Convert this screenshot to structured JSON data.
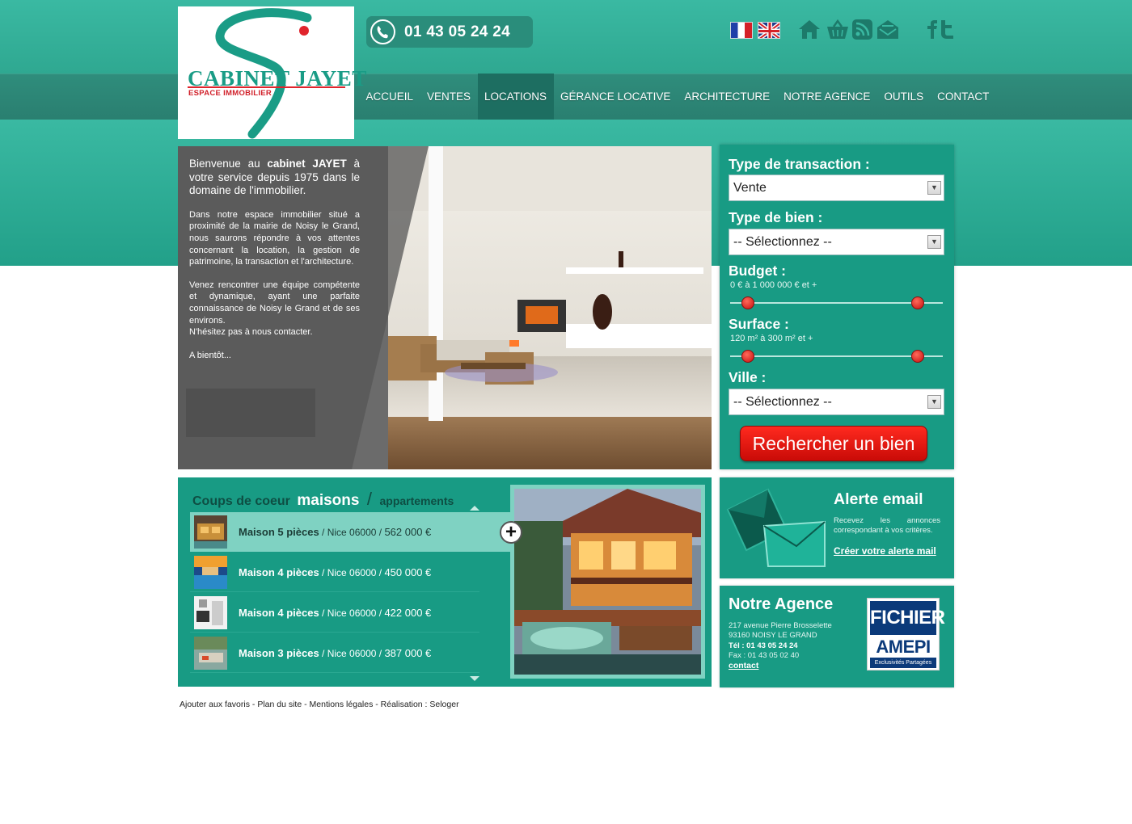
{
  "logo": {
    "line1": "CABINET JAYET",
    "sub": "ESPACE IMMOBILIER"
  },
  "header": {
    "phone": "01 43 05 24 24",
    "icons": [
      "flag-fr",
      "flag-uk",
      "home-icon",
      "basket-icon",
      "rss-icon",
      "mail-icon",
      "facebook-icon",
      "twitter-icon"
    ]
  },
  "nav": [
    "ACCUEIL",
    "VENTES",
    "LOCATIONS",
    "GÉRANCE LOCATIVE",
    "ARCHITECTURE",
    "NOTRE AGENCE",
    "OUTILS",
    "CONTACT"
  ],
  "nav_active": "LOCATIONS",
  "hero": {
    "intro_pre": "Bienvenue au ",
    "intro_bold": "cabinet JAYET",
    "intro_post": " à votre service depuis 1975 dans le domaine de l'immobilier.",
    "p1": "Dans notre espace immobilier situé a proximité de la mairie de Noisy le Grand, nous saurons répondre à vos attentes concernant la location, la gestion de patrimoine, la transaction et l'architecture.",
    "p2a": "Venez rencontrer une équipe compétente et dynamique, ayant une parfaite connaissance de Noisy le Grand et de ses environs.",
    "p2b": "N'hésitez pas à nous contacter.",
    "p3": "A bientôt..."
  },
  "search": {
    "transaction_label": "Type de transaction :",
    "transaction_value": "Vente",
    "bien_label": "Type de bien :",
    "bien_value": "-- Sélectionnez --",
    "budget_label": "Budget :",
    "budget_range": "0 € à 1 000 000 € et +",
    "surface_label": "Surface :",
    "surface_range": "120 m² à 300 m² et +",
    "ville_label": "Ville :",
    "ville_value": "-- Sélectionnez --",
    "button": "Rechercher un bien"
  },
  "coeur": {
    "title": "Coups de coeur",
    "tab_active": "maisons",
    "separator": "/",
    "tab_other": "appartements",
    "items": [
      {
        "name": "Maison 5 pièces",
        "loc": " / Nice 06000 / ",
        "price": "562 000 €"
      },
      {
        "name": "Maison 4 pièces",
        "loc": " / Nice 06000 / ",
        "price": "450 000 €"
      },
      {
        "name": "Maison 4 pièces",
        "loc": " / Nice 06000 / ",
        "price": "422 000 €"
      },
      {
        "name": "Maison 3 pièces",
        "loc": " / Nice 06000 / ",
        "price": "387 000 €"
      }
    ],
    "plus": "+"
  },
  "alerte": {
    "title": "Alerte email",
    "desc": "Recevez les annonces correspondant à vos critères.",
    "link": "Créer votre alerte mail"
  },
  "agence": {
    "title": "Notre Agence",
    "address1": "217 avenue Pierre Brosselette",
    "address2": "93160 NOISY LE GRAND",
    "tel": "Tél : 01 43 05 24 24",
    "fax": "Fax : 01 43 05 02 40",
    "link": "contact",
    "badge_top": "FICHIER",
    "badge_mid": "AMEPI",
    "badge_bot": "Exclusivités Partagées"
  },
  "footer": {
    "fav": "Ajouter aux favoris",
    "plan": "Plan du site",
    "mentions": "Mentions légales",
    "realisation": "Réalisation : Seloger",
    "sep": " - "
  },
  "colors": {
    "teal": "#189b84",
    "teal_light": "#3ab9a2",
    "nav_dark": "#2a7f70",
    "nav_active": "#1d6e61",
    "red_button": "#e0140c"
  }
}
